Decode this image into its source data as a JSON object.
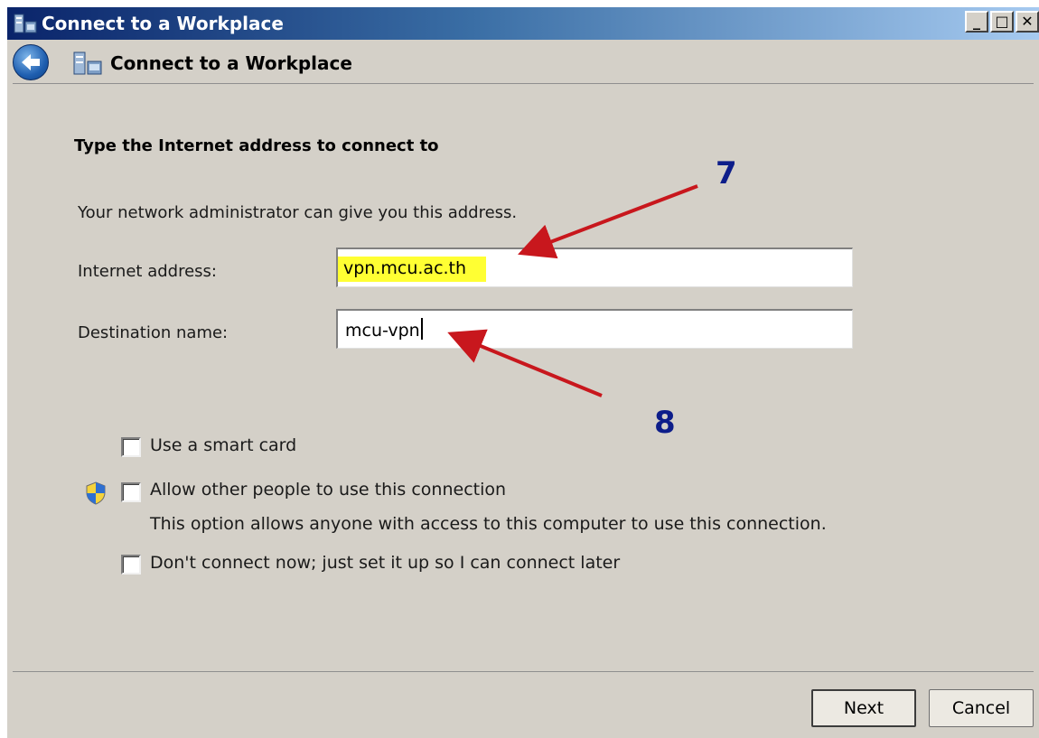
{
  "window": {
    "title": "Connect to a Workplace",
    "controls": {
      "minimize": "_",
      "maximize": "□",
      "close": "✕"
    }
  },
  "nav": {
    "title": "Connect to a Workplace",
    "back_icon": "back-arrow-icon"
  },
  "page": {
    "heading": "Type the Internet address to connect to",
    "subtext": "Your network administrator can give you this address."
  },
  "form": {
    "internet_address": {
      "label": "Internet address:",
      "value": "vpn.mcu.ac.th"
    },
    "destination_name": {
      "label": "Destination name:",
      "value": "mcu-vpn"
    }
  },
  "options": {
    "smart_card": {
      "label": "Use a smart card",
      "checked": false
    },
    "allow_others": {
      "label": "Allow other people to use this connection",
      "description": "This option allows anyone with access to this computer to use this connection.",
      "checked": false,
      "icon": "uac-shield-icon"
    },
    "dont_connect": {
      "label": "Don't connect now; just set it up so I can connect later",
      "checked": false
    }
  },
  "buttons": {
    "next": "Next",
    "cancel": "Cancel"
  },
  "annotations": {
    "step_a": "7",
    "step_b": "8",
    "arrow_color": "#c8171d",
    "number_color": "#0d1d8a"
  },
  "colors": {
    "highlight": "#ffff33",
    "dialog_bg": "#d4d0c8"
  }
}
